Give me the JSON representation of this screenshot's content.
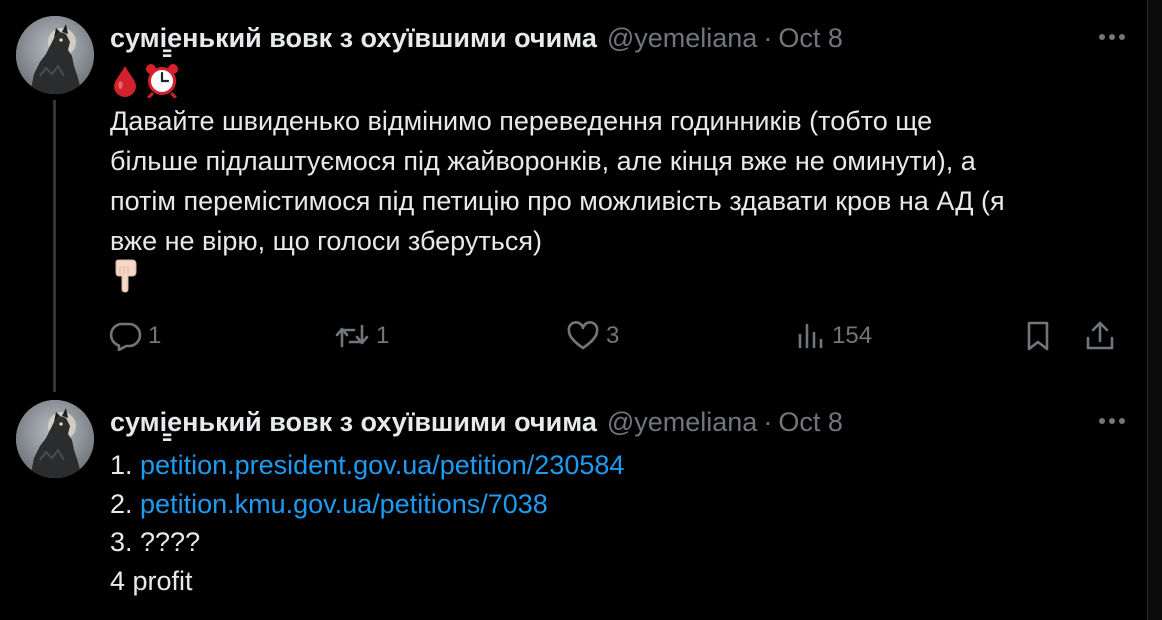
{
  "thread": {
    "tweets": [
      {
        "author": {
          "name": "сумі̳енький вовк з охуївшими очима",
          "handle": "@yemeliana",
          "separator": "·",
          "date": "Oct 8"
        },
        "emojis": [
          "drop-of-blood-emoji",
          "alarm-clock-emoji"
        ],
        "text_lines": [
          "Давайте швиденько відмінимо переведення годинників (тобто ще",
          "більше підлаштуємося під жайворонків, але кінця вже не оминути), а",
          "потім перемістимося під петицію про можливість здавати кров на АД (я",
          "вже не вірю, що голоси зберуться)"
        ],
        "trailing_emoji": "backhand-index-pointing-down-emoji",
        "actions": {
          "replies": "1",
          "reposts": "1",
          "likes": "3",
          "views": "154"
        }
      },
      {
        "author": {
          "name": "сумі̳енький вовк з охуївшими очима",
          "handle": "@yemeliana",
          "separator": "·",
          "date": "Oct 8"
        },
        "list": [
          {
            "prefix": "1. ",
            "link": "petition.president.gov.ua/petition/230584"
          },
          {
            "prefix": "2. ",
            "link": "petition.kmu.gov.ua/petitions/7038"
          },
          {
            "prefix": "3. ????",
            "link": ""
          },
          {
            "prefix": "4 profit",
            "link": ""
          }
        ]
      }
    ]
  },
  "colors": {
    "background": "#000000",
    "text": "#e7e9ea",
    "secondary": "#71767b",
    "link": "#1d9bf0",
    "thread_line": "#333639"
  }
}
